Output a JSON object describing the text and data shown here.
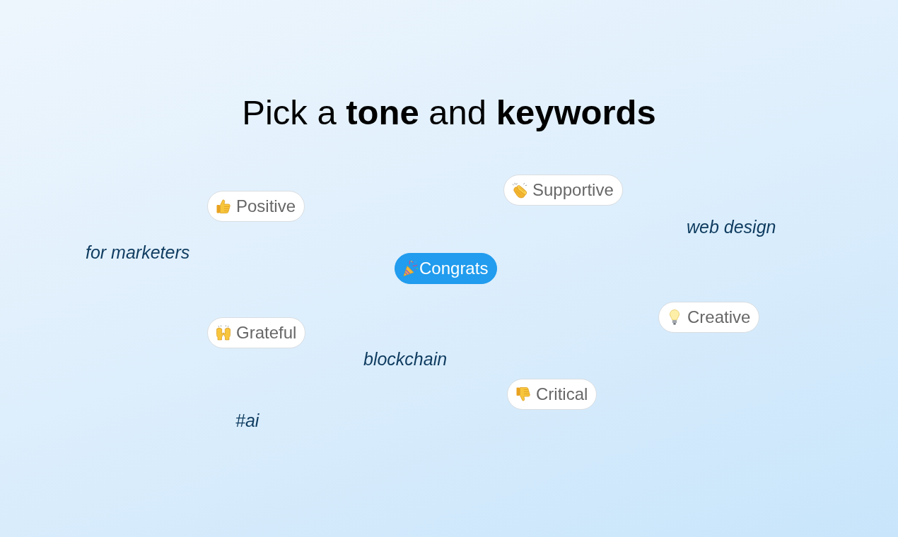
{
  "title": "Pick a **tone** and **keywords**",
  "tones": [
    {
      "label": "Positive",
      "selected": false
    },
    {
      "label": "Supportive",
      "selected": false
    },
    {
      "label": "Congrats",
      "selected": true
    },
    {
      "label": "Grateful",
      "selected": false
    },
    {
      "label": "Creative",
      "selected": false
    },
    {
      "label": "Critical",
      "selected": false
    }
  ],
  "keywords": [
    {
      "label": "for marketers"
    },
    {
      "label": "web design"
    },
    {
      "label": "blockchain"
    },
    {
      "label": "#ai"
    }
  ]
}
